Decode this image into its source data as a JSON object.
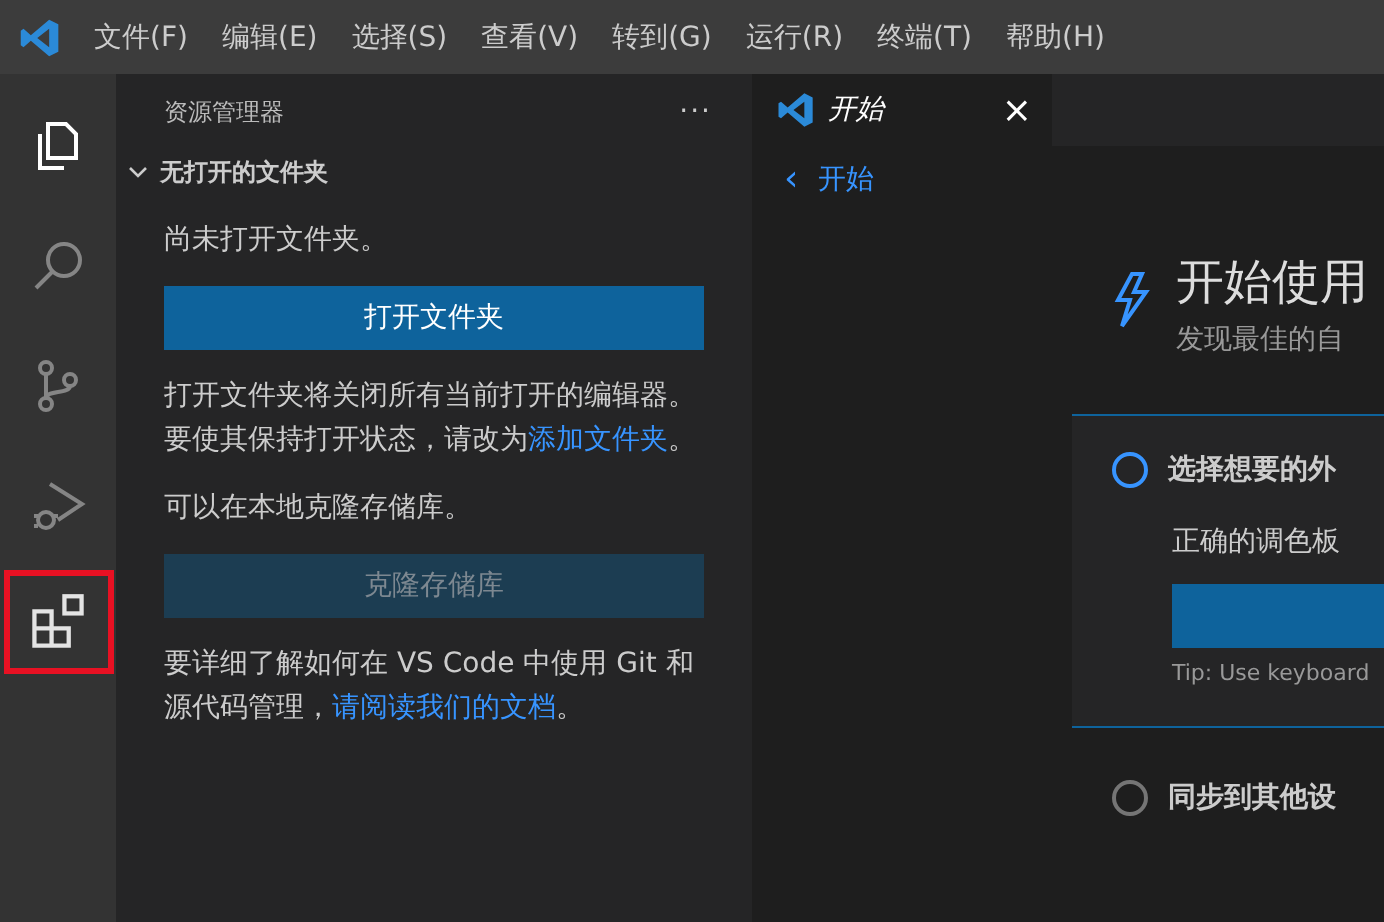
{
  "menu_bar": {
    "items": [
      "文件(F)",
      "编辑(E)",
      "选择(S)",
      "查看(V)",
      "转到(G)",
      "运行(R)",
      "终端(T)",
      "帮助(H)"
    ]
  },
  "activity_bar": {
    "items": [
      {
        "kind": "explorer",
        "selected": true,
        "highlighted": false
      },
      {
        "kind": "search",
        "selected": false,
        "highlighted": false
      },
      {
        "kind": "source-control",
        "selected": false,
        "highlighted": false
      },
      {
        "kind": "run-debug",
        "selected": false,
        "highlighted": false
      },
      {
        "kind": "extensions",
        "selected": false,
        "highlighted": true
      }
    ]
  },
  "sidebar": {
    "title": "资源管理器",
    "more": "···",
    "section": {
      "title": "无打开的文件夹",
      "expanded": true,
      "blocks": [
        {
          "kind": "text",
          "parts": [
            {
              "text": "尚未打开文件夹。"
            }
          ]
        },
        {
          "kind": "button",
          "label": "打开文件夹",
          "disabled": false
        },
        {
          "kind": "text",
          "parts": [
            {
              "text": "打开文件夹将关闭所有当前打开的编辑器。要使其保持打开状态，请改为"
            },
            {
              "text": "添加文件夹",
              "link": true
            },
            {
              "text": "。"
            }
          ]
        },
        {
          "kind": "text",
          "parts": [
            {
              "text": "可以在本地克隆存储库。"
            }
          ]
        },
        {
          "kind": "button",
          "label": "克隆存储库",
          "disabled": true
        },
        {
          "kind": "text",
          "parts": [
            {
              "text": "要详细了解如何在 VS Code 中使用 Git 和源代码管理，"
            },
            {
              "text": "请阅读我们的文档",
              "link": true
            },
            {
              "text": "。"
            }
          ]
        }
      ]
    }
  },
  "editor": {
    "tabs": [
      {
        "label": "开始",
        "selected": true,
        "close": "×"
      }
    ],
    "back_link": {
      "arrow": "‹",
      "label": "开始"
    },
    "walkthrough": {
      "title": "开始使用",
      "subtitle": "发现最佳的自",
      "steps": [
        {
          "title": "选择想要的外",
          "selected": true,
          "description": "正确的调色板",
          "tip": "Tip: Use keyboard"
        },
        {
          "title": "同步到其他设",
          "selected": false
        }
      ]
    }
  }
}
